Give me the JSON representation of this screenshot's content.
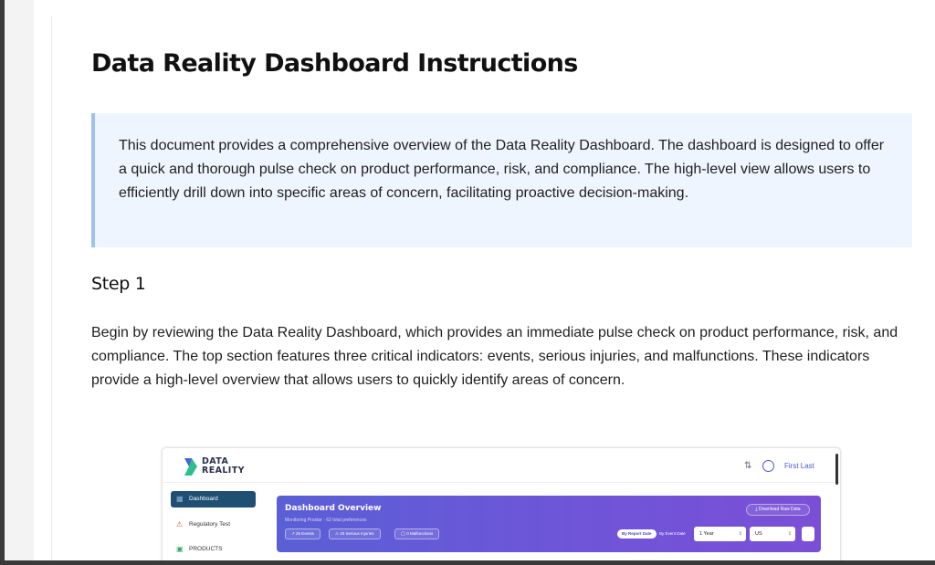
{
  "document": {
    "title": "Data Reality Dashboard Instructions",
    "intro": "This document provides a comprehensive overview of the Data Reality Dashboard. The dashboard is designed to offer a quick and thorough pulse check on product performance, risk, and compliance. The high-level view allows users to efficiently drill down into specific areas of concern, facilitating proactive decision-making.",
    "step1": {
      "heading": "Step 1",
      "body": "Begin by reviewing the Data Reality Dashboard, which provides an immediate pulse check on product performance, risk, and compliance. The top section features three critical indicators: events, serious injuries, and malfunctions. These indicators provide a high-level overview that allows users to quickly identify areas of concern."
    }
  },
  "screenshot": {
    "logo": {
      "line1": "DATA",
      "line2": "REALITY",
      "icon": "data-reality-logo"
    },
    "header": {
      "user_name": "First Last",
      "filter_icon": "sliders-icon",
      "avatar_icon": "user-circle-icon"
    },
    "sidebar": {
      "items": [
        {
          "label": "Dashboard",
          "icon": "grid-icon",
          "active": true
        },
        {
          "label": "Regulatory Test",
          "icon": "alert-icon",
          "active": false
        },
        {
          "label": "PRODUCTS",
          "icon": "box-icon",
          "active": false
        }
      ]
    },
    "overview": {
      "title": "Dashboard Overview",
      "subtitle": "Monitoring Prostar · 62 total preferences",
      "download_label": "⤓  Download Raw Data",
      "badges": [
        "↗ 26 Events",
        "⚠ 20 Serious Injuries",
        "◯ 0 Malfunctions"
      ],
      "toggle_report_date": "By Report Date",
      "toggle_event_date": "By Event Date",
      "period_value": "1 Year",
      "region_value": "US"
    }
  },
  "colors": {
    "callout_bg": "#eef5fe",
    "callout_border": "#9cc2ee",
    "overview_gradient_start": "#5a5fd6",
    "overview_gradient_end": "#7a4fd6",
    "sidebar_active": "#1f4f73"
  }
}
